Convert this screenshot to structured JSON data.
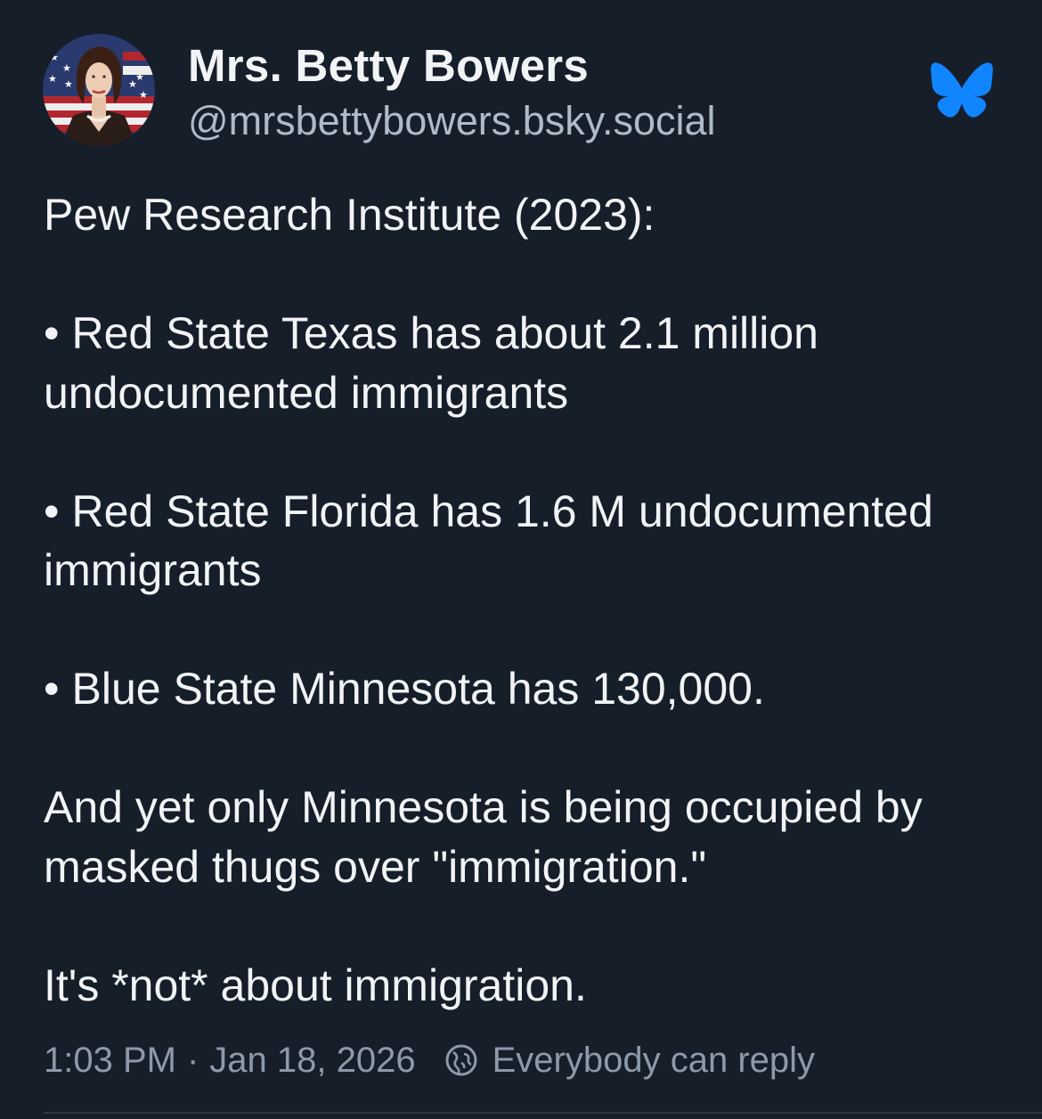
{
  "post": {
    "author": {
      "display_name": "Mrs. Betty Bowers",
      "handle": "@mrsbettybowers.bsky.social",
      "avatar_icon": "avatar-photo"
    },
    "app_logo": "bluesky-butterfly-icon",
    "accent_color": "#1185fe",
    "text": {
      "intro": "Pew Research Institute (2023):",
      "bullets": [
        {
          "dot": "•",
          "text": "Red State Texas has about 2.1 million undocumented immigrants"
        },
        {
          "dot": "•",
          "text": "Red State Florida has 1.6 M undocumented immigrants"
        },
        {
          "dot": "•",
          "text": "Blue State Minnesota has 130,000."
        }
      ],
      "paragraph_1": "And yet only Minnesota is being occupied by masked thugs over \"immigration.\"",
      "paragraph_2": "It's *not* about immigration."
    },
    "meta": {
      "time": "1:03 PM",
      "separator": "·",
      "date": "Jan 18, 2026",
      "reply_icon": "globe-icon",
      "reply_settings": "Everybody can reply"
    }
  }
}
